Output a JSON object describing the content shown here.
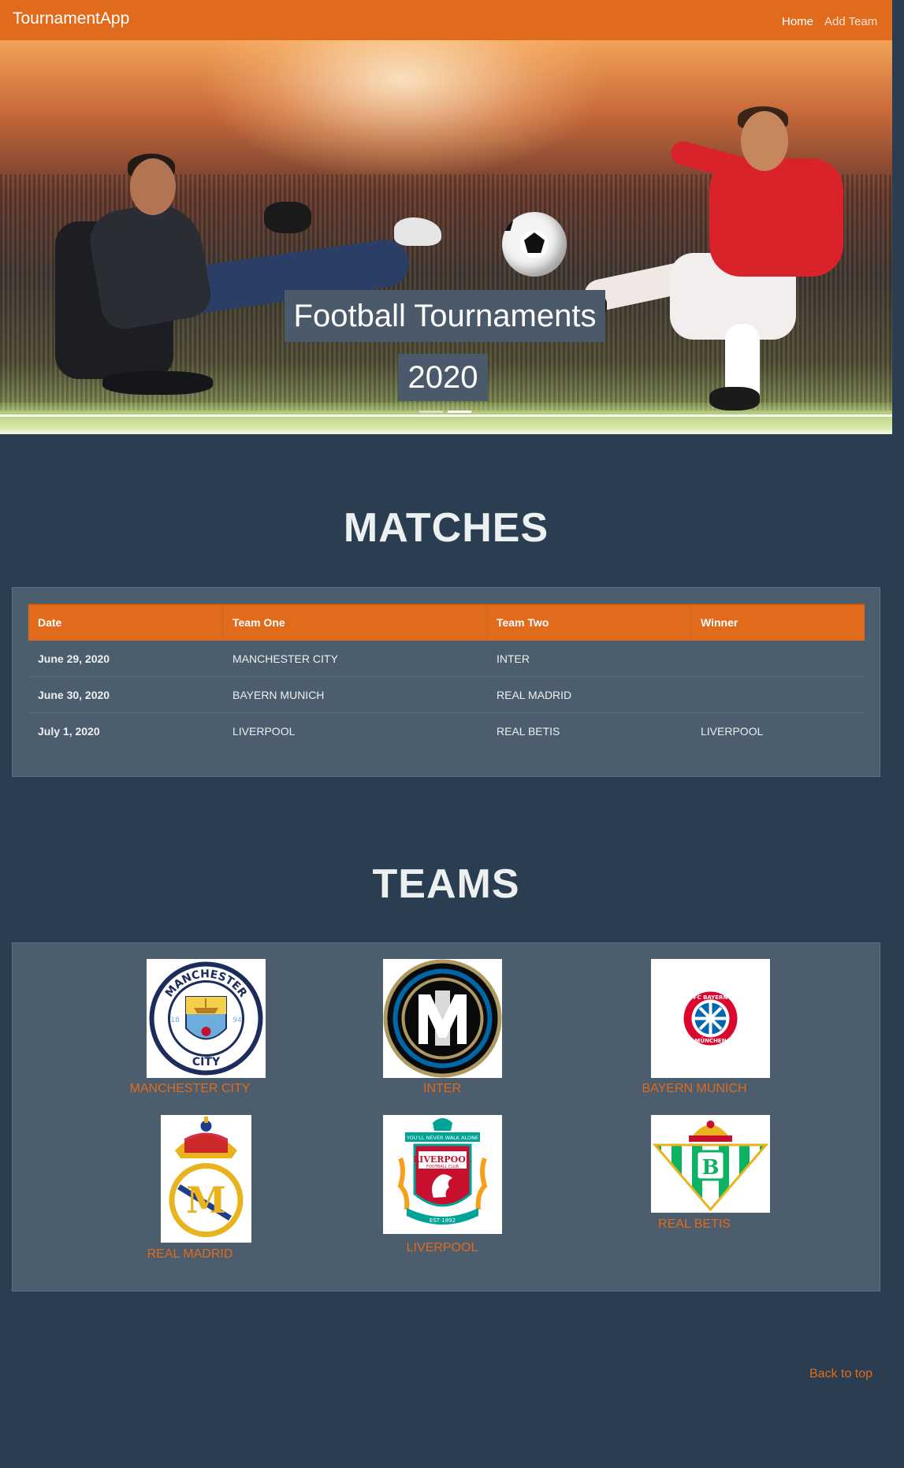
{
  "navbar": {
    "brand": "TournamentApp",
    "links": [
      "Home",
      "Add Team"
    ]
  },
  "hero": {
    "title": "Football Tournaments",
    "year": "2020",
    "slides": 2,
    "active_slide": 2
  },
  "matches": {
    "heading": "MATCHES",
    "columns": [
      "Date",
      "Team One",
      "Team Two",
      "Winner"
    ],
    "rows": [
      [
        "June 29, 2020",
        "MANCHESTER CITY",
        "INTER",
        ""
      ],
      [
        "June 30, 2020",
        "BAYERN MUNICH",
        "REAL MADRID",
        ""
      ],
      [
        "July 1, 2020",
        "LIVERPOOL",
        "REAL BETIS",
        "LIVERPOOL"
      ]
    ]
  },
  "teams": {
    "heading": "TEAMS",
    "items": [
      {
        "name": "MANCHESTER CITY",
        "logo": "manchester-city-crest",
        "logo_text": [
          "MANCHESTER",
          "CITY",
          "18",
          "94"
        ]
      },
      {
        "name": "INTER",
        "logo": "inter-crest"
      },
      {
        "name": "BAYERN MUNICH",
        "logo": "bayern-crest",
        "logo_text": [
          "FC BAYERN",
          "MÜNCHEN"
        ]
      },
      {
        "name": "REAL MADRID",
        "logo": "real-madrid-crest"
      },
      {
        "name": "LIVERPOOL",
        "logo": "liverpool-crest",
        "logo_text": [
          "YOU'LL NEVER WALK ALONE",
          "LIVERPOOL",
          "FOOTBALL CLUB",
          "EST·1892"
        ]
      },
      {
        "name": "REAL BETIS",
        "logo": "real-betis-crest"
      }
    ]
  },
  "footer": {
    "back_to_top": "Back to top"
  },
  "colors": {
    "accent": "#e16b1c",
    "background": "#2b3e51",
    "panel": "#4c5d6d",
    "caption_bg": "#4a5a6b"
  }
}
